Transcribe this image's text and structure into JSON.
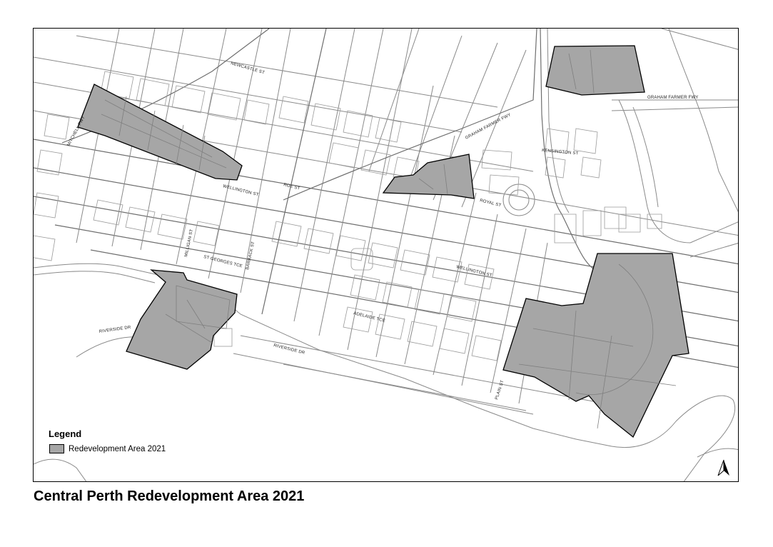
{
  "title": "Central Perth Redevelopment Area 2021",
  "legend": {
    "title": "Legend",
    "items": [
      {
        "label": "Redevelopment Area 2021",
        "color": "#a6a6a6"
      }
    ]
  },
  "streets": {
    "newcastle": "NEWCASTLE ST",
    "mitchell": "MITCHELL FWY",
    "graham_farmer_1": "GRAHAM FARMER FWY",
    "graham_farmer_2": "GRAHAM FARMER FWY",
    "kensington": "KENSINGTON ST",
    "wellington_west": "WELLINGTON ST",
    "roe": "ROE ST",
    "royal": "ROYAL ST",
    "wellington_east": "WELLINGTON ST",
    "milligan": "MILLIGAN ST",
    "st_georges": "ST GEORGES TCE",
    "barrack": "BARRACK ST",
    "adelaide": "ADELAIDE TCE",
    "riverside_dr_west": "RIVERSIDE DR",
    "riverside_dr": "RIVERSIDE DR",
    "plain": "PLAIN ST"
  },
  "map": {
    "base_color": "#ffffff",
    "road_color": "#8a8a8a",
    "redevelopment_fill": "#a6a6a6",
    "north_arrow_icon": "north-arrow-icon"
  }
}
